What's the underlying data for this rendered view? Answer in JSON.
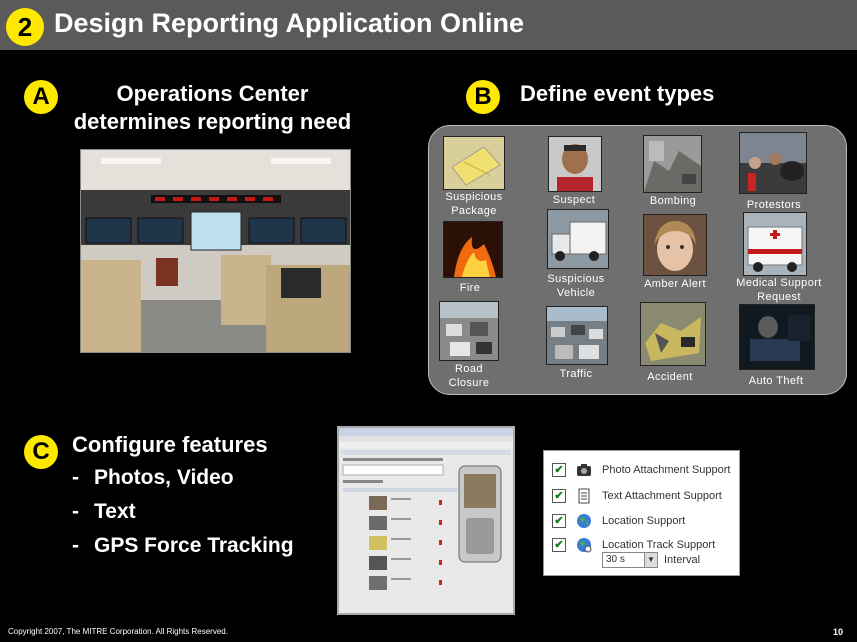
{
  "header": {
    "number": "2",
    "title": "Design Reporting Application Online"
  },
  "section_a": {
    "letter": "A",
    "heading_line1": "Operations Center",
    "heading_line2": "determines reporting need"
  },
  "section_b": {
    "letter": "B",
    "heading": "Define event types",
    "events": [
      {
        "line1": "Suspicious",
        "line2": "Package"
      },
      {
        "line1": "Suspect",
        "line2": ""
      },
      {
        "line1": "Bombing",
        "line2": ""
      },
      {
        "line1": "Protestors",
        "line2": ""
      },
      {
        "line1": "Fire",
        "line2": ""
      },
      {
        "line1": "Suspicious",
        "line2": "Vehicle"
      },
      {
        "line1": "Amber Alert",
        "line2": ""
      },
      {
        "line1": "Medical Support",
        "line2": "Request"
      },
      {
        "line1": "Road",
        "line2": "Closure"
      },
      {
        "line1": "Traffic",
        "line2": ""
      },
      {
        "line1": "Accident",
        "line2": ""
      },
      {
        "line1": "Auto Theft",
        "line2": ""
      }
    ]
  },
  "section_c": {
    "letter": "C",
    "heading": "Configure features",
    "bullets": [
      "Photos, Video",
      "Text",
      "GPS Force Tracking"
    ]
  },
  "options": {
    "items": [
      {
        "label": "Photo Attachment Support",
        "checked": true,
        "icon": "camera-icon"
      },
      {
        "label": "Text Attachment Support",
        "checked": true,
        "icon": "document-icon"
      },
      {
        "label": "Location Support",
        "checked": true,
        "icon": "globe-icon"
      },
      {
        "label": "Location Track Support",
        "checked": true,
        "icon": "globe-track-icon"
      }
    ],
    "interval_value": "30 s",
    "interval_label": "Interval"
  },
  "footer": {
    "copyright": "Copyright 2007, The MITRE Corporation.  All Rights Reserved.",
    "page": "10"
  },
  "colors": {
    "accent": "#ffe800",
    "titlebar": "#5a5a5a",
    "panel": "#6f6f6f"
  }
}
